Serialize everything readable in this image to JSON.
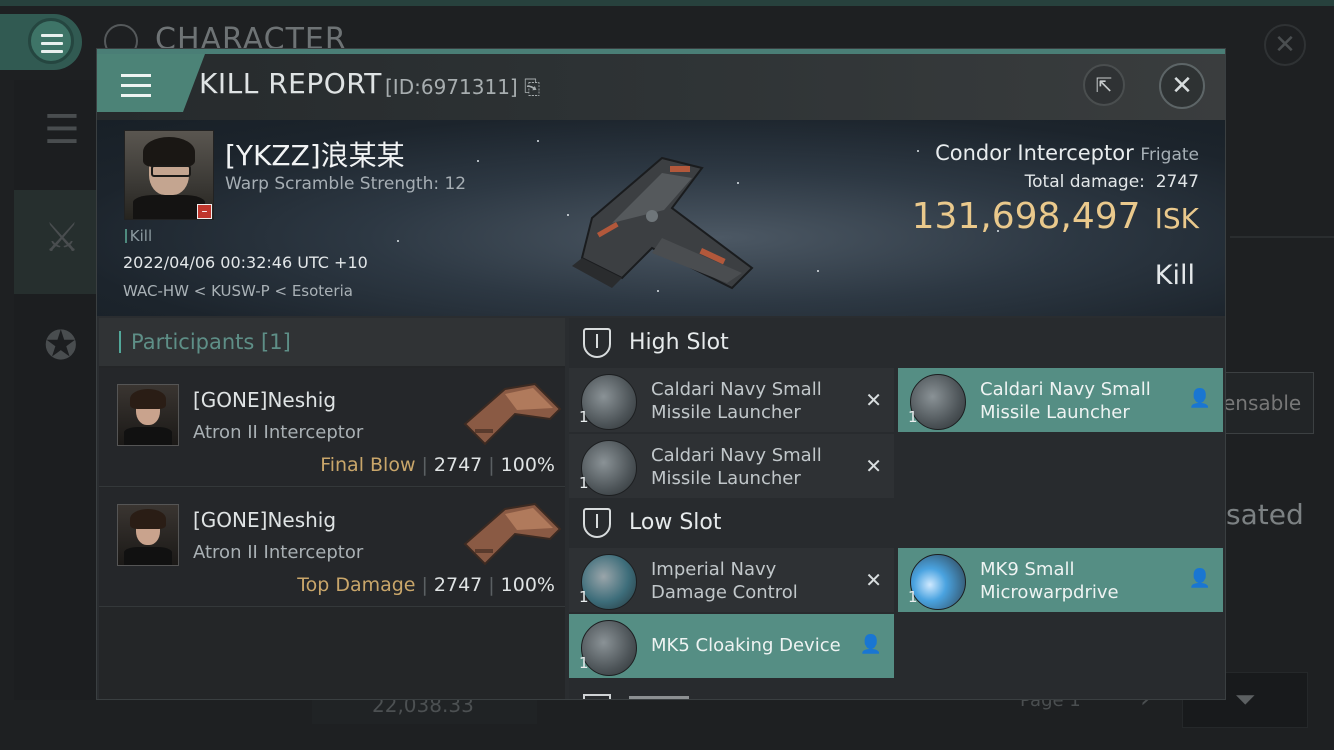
{
  "background": {
    "window_title": "CHARACTER",
    "partial_label_right": "ensable",
    "partial_label_sated": "sated",
    "balance": "22,038.33",
    "page_label": "Page 1"
  },
  "kill_report": {
    "title": "KILL REPORT",
    "id_label": "[ID:6971311]",
    "victim": {
      "name": "[YKZZ]浪某某",
      "warp_scramble": "Warp Scramble Strength: 12",
      "kill_tag": "Kill",
      "datetime": "2022/04/06 00:32:46 UTC +10",
      "location": "WAC-HW < KUSW-P < Esoteria"
    },
    "ship": {
      "name": "Condor Interceptor",
      "class": "Frigate",
      "total_damage_label": "Total damage:",
      "total_damage": "2747",
      "isk_value": "131,698,497",
      "isk_unit": "ISK",
      "result": "Kill"
    },
    "participants": {
      "title": "Participants",
      "count": "[1]",
      "rows": [
        {
          "name": "[GONE]Neshig",
          "ship": "Atron II Interceptor",
          "role": "Final Blow",
          "damage": "2747",
          "percent": "100%"
        },
        {
          "name": "[GONE]Neshig",
          "ship": "Atron II Interceptor",
          "role": "Top Damage",
          "damage": "2747",
          "percent": "100%"
        }
      ]
    },
    "fitting": {
      "high_slot_title": "High Slot",
      "low_slot_title": "Low Slot",
      "high_slot": [
        {
          "qty": "1",
          "name": "Caldari Navy Small Missile Launcher",
          "status": "destroyed"
        },
        {
          "qty": "1",
          "name": "Caldari Navy Small Missile Launcher",
          "status": "dropped"
        },
        {
          "qty": "1",
          "name": "Caldari Navy Small Missile Launcher",
          "status": "destroyed"
        }
      ],
      "low_slot": [
        {
          "qty": "1",
          "name": "Imperial Navy Damage Control",
          "status": "destroyed"
        },
        {
          "qty": "1",
          "name": "MK9 Small Microwarpdrive",
          "status": "dropped"
        },
        {
          "qty": "1",
          "name": "MK5 Cloaking Device",
          "status": "dropped"
        }
      ]
    }
  },
  "colors": {
    "accent": "#4c8377",
    "isk_gold": "#eac98c",
    "role_gold": "#c9a66a",
    "dropped_bg": "#558e84",
    "corp_badge": "#c0362c"
  },
  "icons": {
    "menu": "hamburger-icon",
    "external": "external-link-icon",
    "close": "close-icon",
    "slot": "shield-slot-icon",
    "destroyed": "x-icon",
    "dropped": "person-icon"
  }
}
